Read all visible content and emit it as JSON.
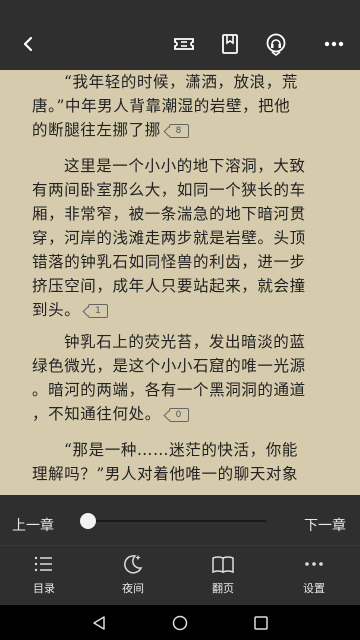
{
  "topbar": {
    "icons": [
      "back-icon",
      "ticket-icon",
      "bookmark-icon",
      "audio-listen-icon",
      "more-icon"
    ]
  },
  "reader": {
    "paragraphs": [
      {
        "lines": [
          "“我年轻的时候，潇洒，放浪，荒",
          "唐。”中年男人背靠潮湿的岩壁，把他",
          "的断腿往左挪了挪"
        ],
        "comments": "8"
      },
      {
        "lines": [
          "这里是一个小小的地下溶洞，大致",
          "有两间卧室那么大，如同一个狭长的车",
          "厢，非常窄，被一条湍急的地下暗河贯",
          "穿，河岸的浅滩走两步就是岩壁。头顶",
          "错落的钟乳石如同怪兽的利齿，进一步",
          "挤压空间，成年人只要站起来，就会撞",
          "到头。"
        ],
        "comments": "1"
      },
      {
        "lines": [
          "钟乳石上的荧光苔，发出暗淡的蓝",
          "绿色微光，是这个小小石窟的唯一光源",
          "。暗河的两端，各有一个黑洞洞的通道",
          "，不知通往何处。"
        ],
        "comments": "0"
      },
      {
        "lines": [
          "“那是一种……迷茫的快活，你能",
          "理解吗？”男人对着他唯一的聊天对象"
        ]
      }
    ]
  },
  "bottom": {
    "prev_chapter": "上一章",
    "next_chapter": "下一章",
    "progress": 0.0,
    "tabs": [
      {
        "label": "目录",
        "icon": "catalog-icon"
      },
      {
        "label": "夜间",
        "icon": "night-mode-icon"
      },
      {
        "label": "翻页",
        "icon": "page-turn-icon"
      },
      {
        "label": "设置",
        "icon": "settings-icon"
      }
    ]
  },
  "navbar": {
    "icons": [
      "nav-back-icon",
      "nav-home-icon",
      "nav-recent-icon"
    ]
  },
  "colors": {
    "page_bg": "#d6ccad",
    "bar_bg": "#2f2f2f",
    "text": "#222222"
  }
}
